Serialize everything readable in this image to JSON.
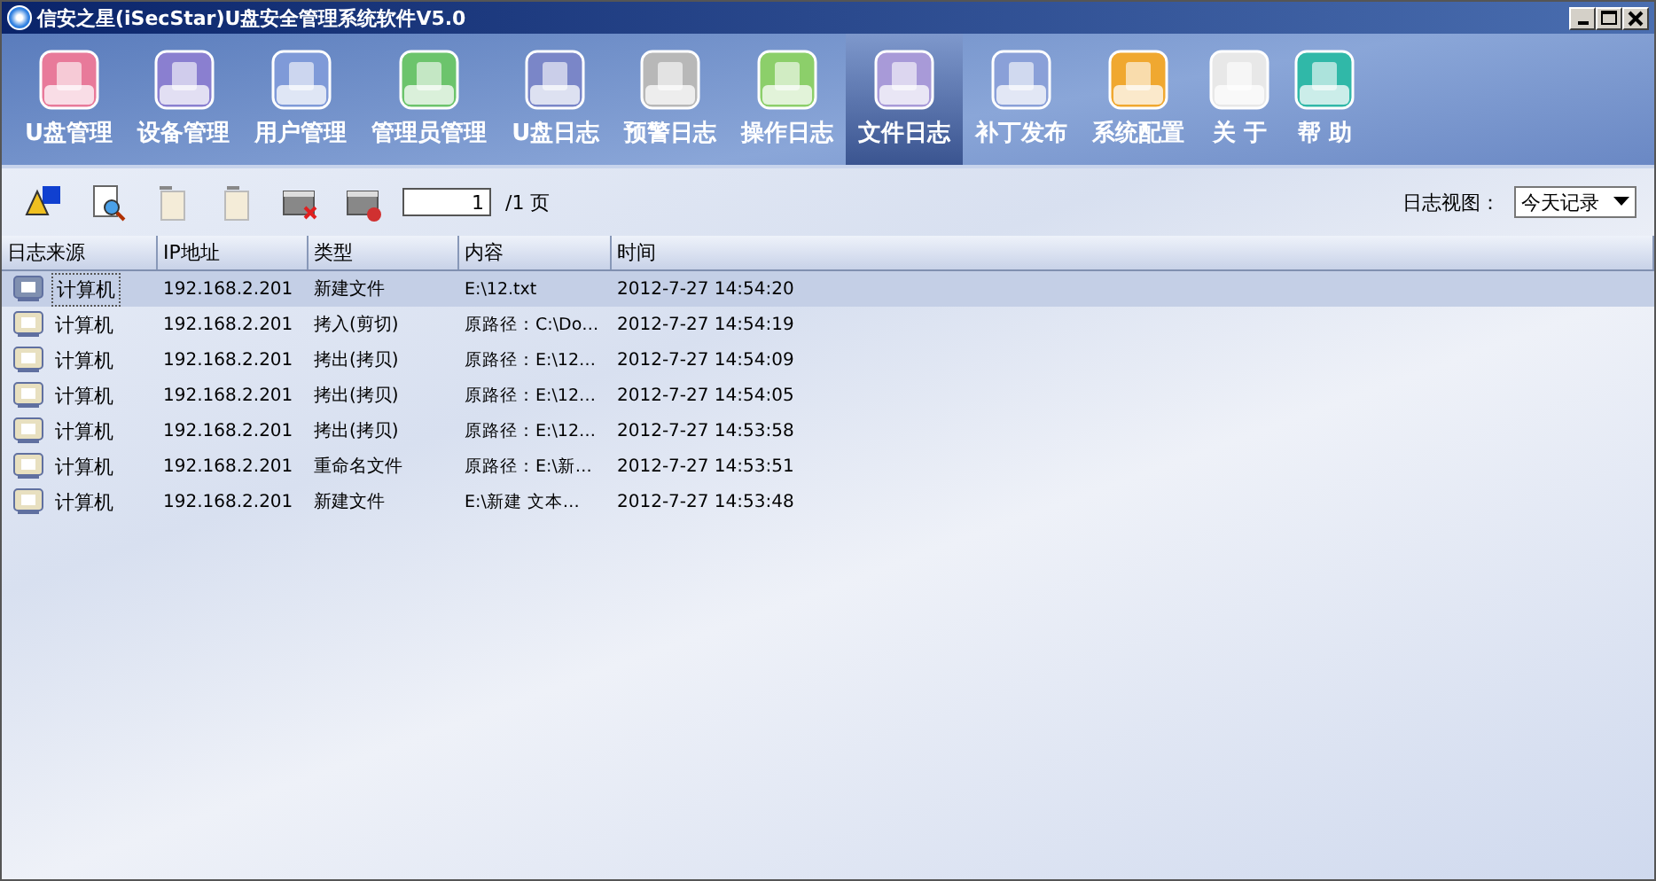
{
  "window": {
    "title": "信安之星(iSecStar)U盘安全管理系统软件V5.0"
  },
  "nav": [
    {
      "label": "U盘管理",
      "selected": false
    },
    {
      "label": "设备管理",
      "selected": false
    },
    {
      "label": "用户管理",
      "selected": false
    },
    {
      "label": "管理员管理",
      "selected": false
    },
    {
      "label": "U盘日志",
      "selected": false
    },
    {
      "label": "预警日志",
      "selected": false
    },
    {
      "label": "操作日志",
      "selected": false
    },
    {
      "label": "文件日志",
      "selected": true
    },
    {
      "label": "补丁发布",
      "selected": false
    },
    {
      "label": "系统配置",
      "selected": false
    },
    {
      "label": "关 于",
      "selected": false
    },
    {
      "label": "帮 助",
      "selected": false
    }
  ],
  "toolbar": {
    "page_value": "1",
    "page_total": "/1 页",
    "view_label": "日志视图：",
    "view_value": "今天记录"
  },
  "table": {
    "columns": [
      "日志来源",
      "IP地址",
      "类型",
      "内容",
      "时间"
    ],
    "rows": [
      {
        "source": "计算机",
        "ip": "192.168.2.201",
        "type": "新建文件",
        "content": "E:\\12.txt",
        "time": "2012-7-27 14:54:20",
        "selected": true
      },
      {
        "source": "计算机",
        "ip": "192.168.2.201",
        "type": "拷入(剪切)",
        "content": "原路径：C:\\Do…",
        "time": "2012-7-27 14:54:19",
        "selected": false
      },
      {
        "source": "计算机",
        "ip": "192.168.2.201",
        "type": "拷出(拷贝)",
        "content": "原路径：E:\\12…",
        "time": "2012-7-27 14:54:09",
        "selected": false
      },
      {
        "source": "计算机",
        "ip": "192.168.2.201",
        "type": "拷出(拷贝)",
        "content": "原路径：E:\\12…",
        "time": "2012-7-27 14:54:05",
        "selected": false
      },
      {
        "source": "计算机",
        "ip": "192.168.2.201",
        "type": "拷出(拷贝)",
        "content": "原路径：E:\\12…",
        "time": "2012-7-27 14:53:58",
        "selected": false
      },
      {
        "source": "计算机",
        "ip": "192.168.2.201",
        "type": "重命名文件",
        "content": "原路径：E:\\新…",
        "time": "2012-7-27 14:53:51",
        "selected": false
      },
      {
        "source": "计算机",
        "ip": "192.168.2.201",
        "type": "新建文件",
        "content": "E:\\新建 文本…",
        "time": "2012-7-27 14:53:48",
        "selected": false
      }
    ]
  }
}
